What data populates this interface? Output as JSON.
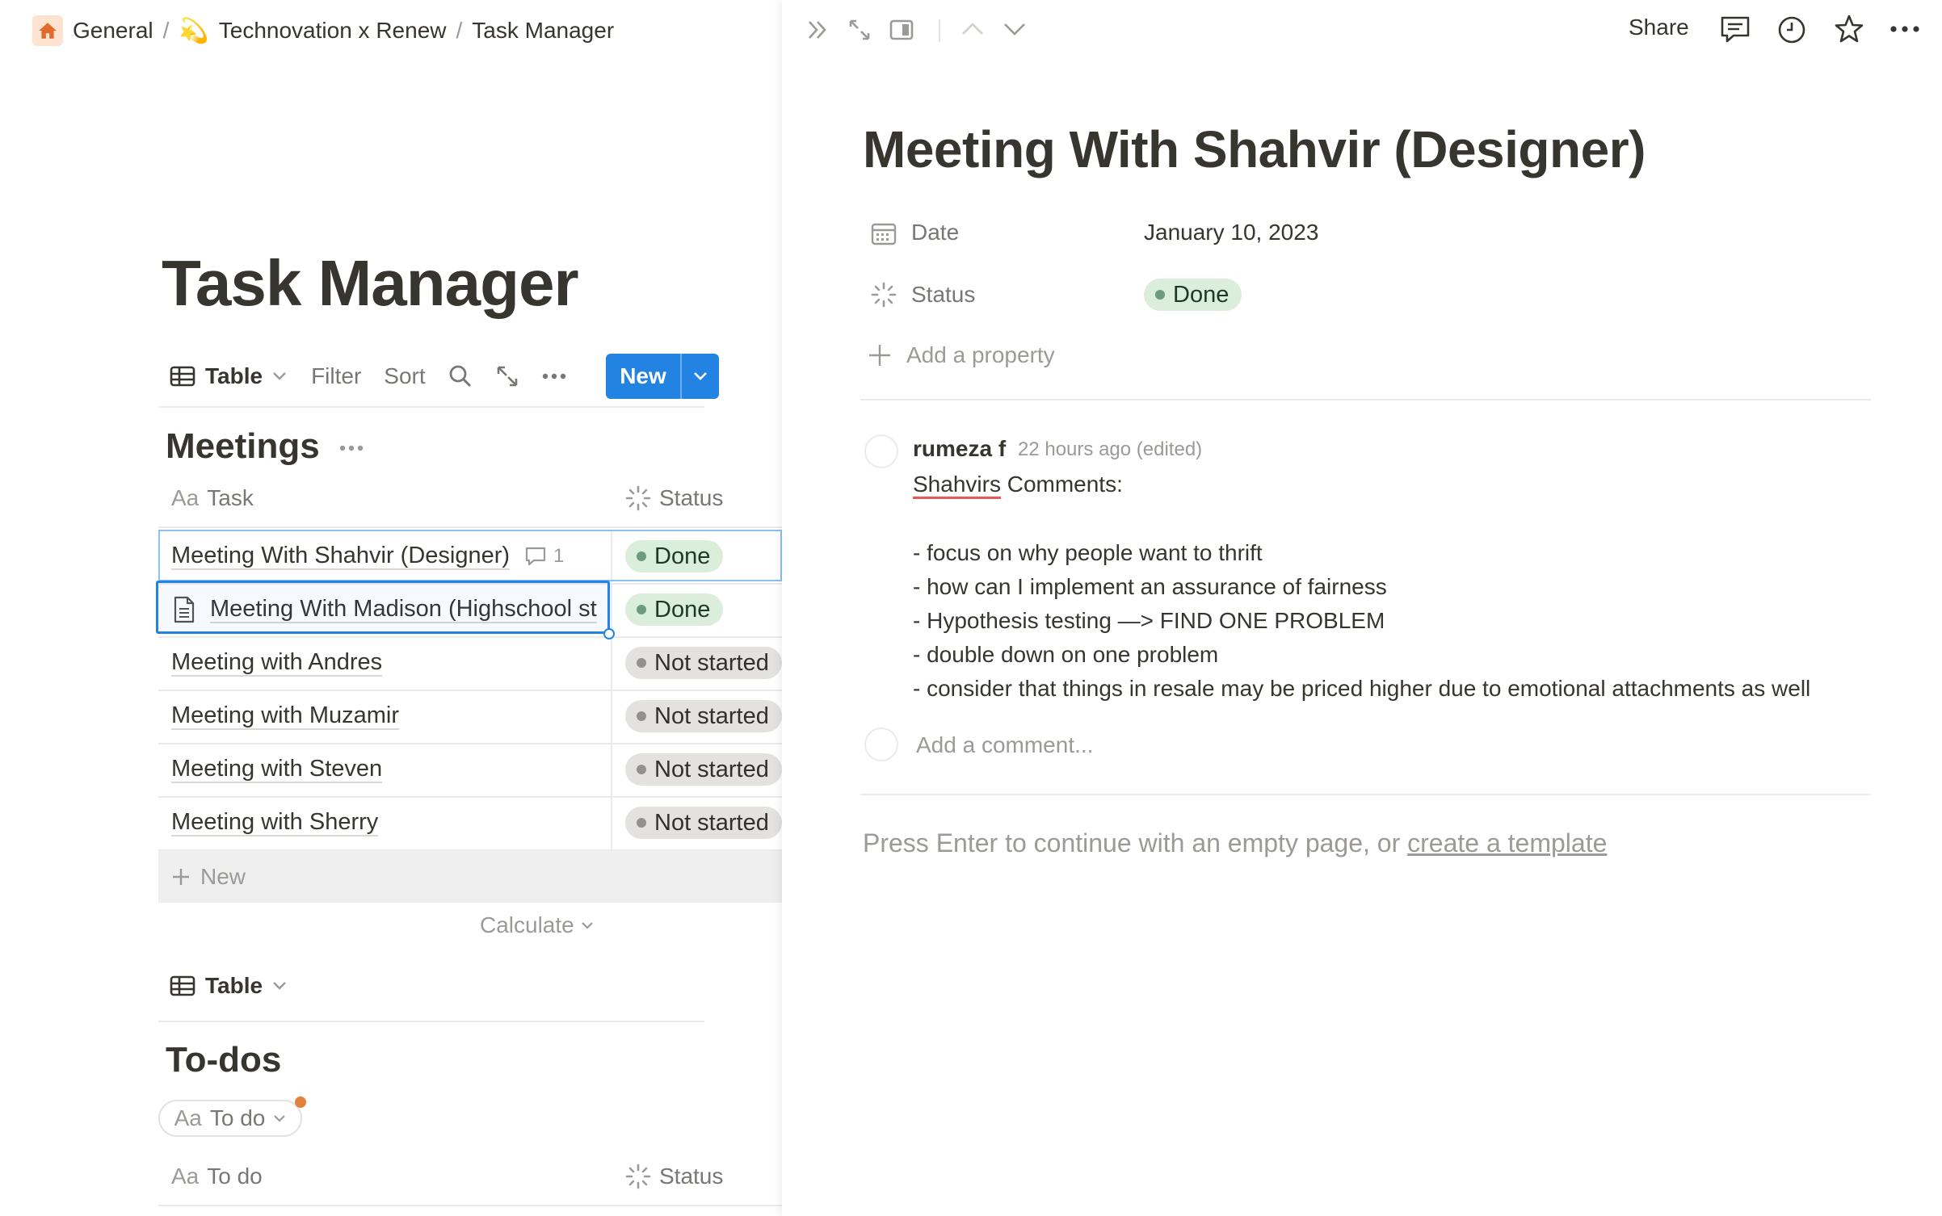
{
  "breadcrumb": {
    "items": [
      "General",
      "Technovation x Renew",
      "Task Manager"
    ],
    "separator": "/",
    "emoji_2": "💫"
  },
  "page": {
    "title": "Task Manager"
  },
  "toolbar": {
    "view_label": "Table",
    "filter_label": "Filter",
    "sort_label": "Sort",
    "new_label": "New"
  },
  "meetings": {
    "title": "Meetings",
    "col_task": "Task",
    "col_status": "Status",
    "col_prefix": "Aa",
    "rows": [
      {
        "task": "Meeting With Shahvir (Designer)",
        "status": "Done",
        "comments": "1"
      },
      {
        "task": "Meeting With Madison (Highschool st",
        "status": "Done"
      },
      {
        "task": "Meeting with Andres",
        "status": "Not started"
      },
      {
        "task": "Meeting with Muzamir",
        "status": "Not started"
      },
      {
        "task": "Meeting with Steven",
        "status": "Not started"
      },
      {
        "task": "Meeting with Sherry",
        "status": "Not started"
      }
    ],
    "new_row_label": "New",
    "calculate_label": "Calculate"
  },
  "second_view": {
    "view_label": "Table"
  },
  "todos": {
    "title": "To-dos",
    "chip_label": "To do",
    "col_task": "To do",
    "col_status": "Status",
    "col_prefix": "Aa"
  },
  "peek": {
    "share_label": "Share",
    "title": "Meeting With Shahvir (Designer)",
    "properties": [
      {
        "label": "Date",
        "value": "January 10, 2023"
      },
      {
        "label": "Status",
        "value": "Done"
      }
    ],
    "add_property_label": "Add a property",
    "comment": {
      "author": "rumeza f",
      "time": "22 hours ago (edited)",
      "first_word": "Shahvirs",
      "first_rest": " Comments:",
      "lines": [
        "- focus on why people want to thrift",
        "- how can I implement an assurance of fairness",
        "- Hypothesis testing —> FIND ONE PROBLEM",
        "- double down on one problem",
        "- consider that things in resale may be priced higher due to emotional attachments as well"
      ]
    },
    "add_comment_placeholder": "Add a comment...",
    "hint_text": "Press Enter to continue with an empty page, or ",
    "hint_link": "create a template"
  },
  "colors": {
    "accent": "#2383e2",
    "done_bg": "#dbeddb",
    "done_dot": "#6c9b7d",
    "not_started_bg": "#e3e2e0",
    "not_started_dot": "#91918e",
    "notification_dot": "#e0823d"
  },
  "icons": {
    "home": "home-icon",
    "view": "table-icon",
    "search": "search-icon",
    "expand": "expand-icon",
    "more": "more-icon",
    "comment": "comment-icon",
    "history": "clock-icon",
    "favorite": "star-icon",
    "status": "status-icon",
    "date": "calendar-icon",
    "page": "page-icon"
  }
}
